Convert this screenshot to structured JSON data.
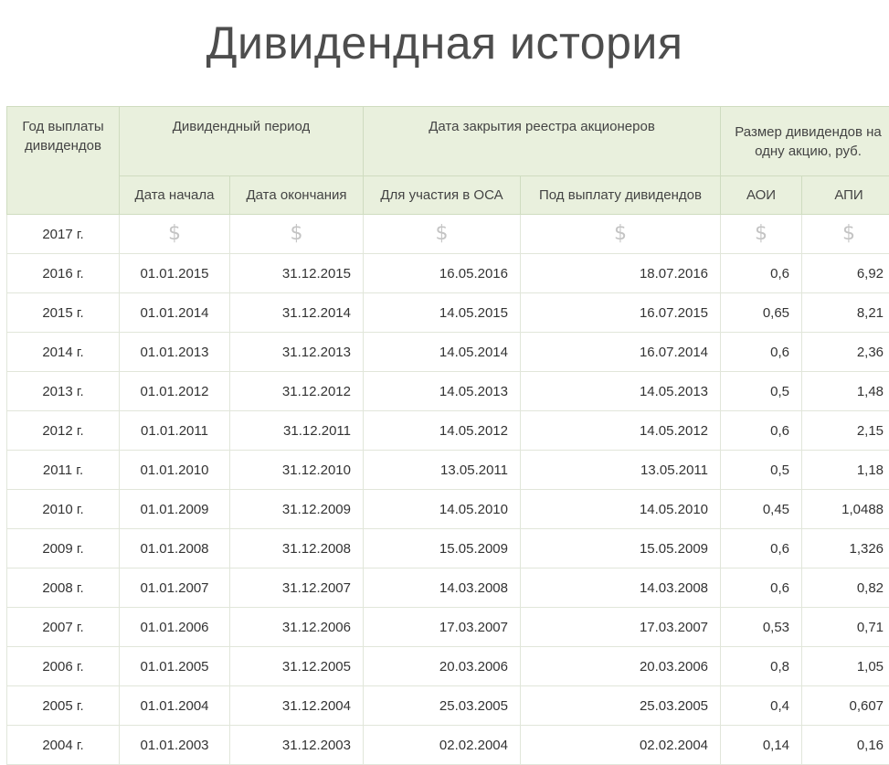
{
  "page": {
    "title": "Дивидендная история"
  },
  "table": {
    "headers": {
      "year": "Год выплаты дивидендов",
      "period": "Дивидендный период",
      "registry": "Дата закрытия реестра акционеров",
      "amount": "Размер дивидендов на одну акцию, руб.",
      "start": "Дата начала",
      "end": "Дата окончания",
      "osa": "Для участия в ОСА",
      "payout": "Под выплату дивидендов",
      "aoi": "АОИ",
      "api": "АПИ"
    },
    "pending_icon": "dollar-icon",
    "pending_glyph": "$",
    "pending_row": {
      "year": "2017 г."
    },
    "rows": [
      {
        "year": "2016 г.",
        "start": "01.01.2015",
        "end": "31.12.2015",
        "osa": "16.05.2016",
        "payout": "18.07.2016",
        "aoi": "0,6",
        "api": "6,92"
      },
      {
        "year": "2015 г.",
        "start": "01.01.2014",
        "end": "31.12.2014",
        "osa": "14.05.2015",
        "payout": "16.07.2015",
        "aoi": "0,65",
        "api": "8,21"
      },
      {
        "year": "2014 г.",
        "start": "01.01.2013",
        "end": "31.12.2013",
        "osa": "14.05.2014",
        "payout": "16.07.2014",
        "aoi": "0,6",
        "api": "2,36"
      },
      {
        "year": "2013 г.",
        "start": "01.01.2012",
        "end": "31.12.2012",
        "osa": "14.05.2013",
        "payout": "14.05.2013",
        "aoi": "0,5",
        "api": "1,48"
      },
      {
        "year": "2012 г.",
        "start": "01.01.2011",
        "end": "31.12.2011",
        "osa": "14.05.2012",
        "payout": "14.05.2012",
        "aoi": "0,6",
        "api": "2,15"
      },
      {
        "year": "2011 г.",
        "start": "01.01.2010",
        "end": "31.12.2010",
        "osa": "13.05.2011",
        "payout": "13.05.2011",
        "aoi": "0,5",
        "api": "1,18"
      },
      {
        "year": "2010 г.",
        "start": "01.01.2009",
        "end": "31.12.2009",
        "osa": "14.05.2010",
        "payout": "14.05.2010",
        "aoi": "0,45",
        "api": "1,0488"
      },
      {
        "year": "2009 г.",
        "start": "01.01.2008",
        "end": "31.12.2008",
        "osa": "15.05.2009",
        "payout": "15.05.2009",
        "aoi": "0,6",
        "api": "1,326"
      },
      {
        "year": "2008 г.",
        "start": "01.01.2007",
        "end": "31.12.2007",
        "osa": "14.03.2008",
        "payout": "14.03.2008",
        "aoi": "0,6",
        "api": "0,82"
      },
      {
        "year": "2007 г.",
        "start": "01.01.2006",
        "end": "31.12.2006",
        "osa": "17.03.2007",
        "payout": "17.03.2007",
        "aoi": "0,53",
        "api": "0,71"
      },
      {
        "year": "2006 г.",
        "start": "01.01.2005",
        "end": "31.12.2005",
        "osa": "20.03.2006",
        "payout": "20.03.2006",
        "aoi": "0,8",
        "api": "1,05"
      },
      {
        "year": "2005 г.",
        "start": "01.01.2004",
        "end": "31.12.2004",
        "osa": "25.03.2005",
        "payout": "25.03.2005",
        "aoi": "0,4",
        "api": "0,607"
      },
      {
        "year": "2004 г.",
        "start": "01.01.2003",
        "end": "31.12.2003",
        "osa": "02.02.2004",
        "payout": "02.02.2004",
        "aoi": "0,14",
        "api": "0,16"
      }
    ],
    "colors": {
      "header_bg": "#e9f0dd",
      "header_border": "#cfdcc0",
      "row_border": "#e1e6da",
      "pending_icon": "#c4c4c4"
    }
  }
}
